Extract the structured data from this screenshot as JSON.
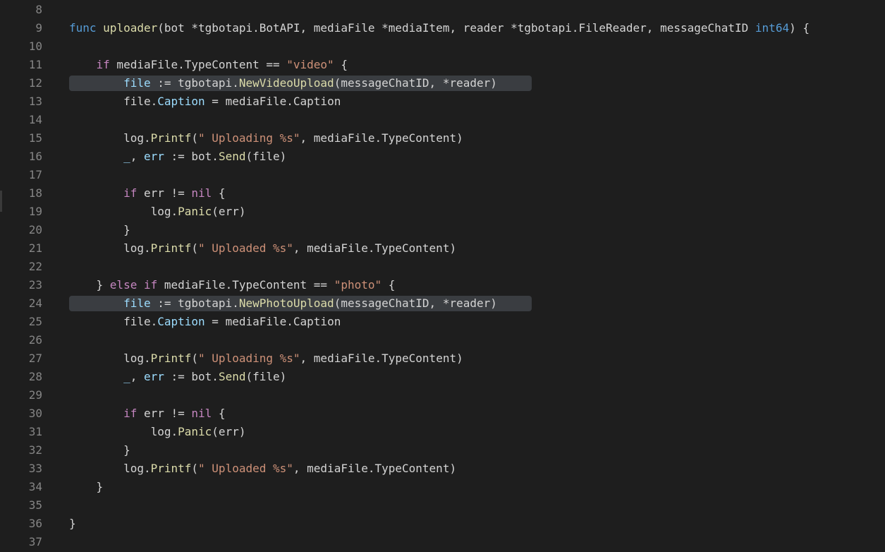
{
  "colors": {
    "background": "#1e1e1e",
    "line_number": "#858585",
    "keyword": "#c586c0",
    "function": "#dcdcaa",
    "string": "#ce9178",
    "variable": "#9cdcfe",
    "type": "#569cd6",
    "text": "#d4d4d4",
    "line_highlight": "#3a3d41"
  },
  "editor": {
    "lines": [
      {
        "number": "8",
        "highlight": false,
        "tokens": []
      },
      {
        "number": "9",
        "highlight": false,
        "tokens": [
          {
            "c": "type",
            "t": "func"
          },
          {
            "c": "plain",
            "t": " "
          },
          {
            "c": "fn",
            "t": "uploader"
          },
          {
            "c": "plain",
            "t": "(bot *tgbotapi.BotAPI, mediaFile *mediaItem, reader *tgbotapi.FileReader, messageChatID "
          },
          {
            "c": "type",
            "t": "int64"
          },
          {
            "c": "plain",
            "t": ") {"
          }
        ]
      },
      {
        "number": "10",
        "highlight": false,
        "tokens": []
      },
      {
        "number": "11",
        "highlight": false,
        "tokens": [
          {
            "c": "plain",
            "t": "    "
          },
          {
            "c": "kw",
            "t": "if"
          },
          {
            "c": "plain",
            "t": " mediaFile.TypeContent == "
          },
          {
            "c": "str",
            "t": "\"video\""
          },
          {
            "c": "plain",
            "t": " {"
          }
        ]
      },
      {
        "number": "12",
        "highlight": true,
        "tokens": [
          {
            "c": "plain",
            "t": "        "
          },
          {
            "c": "var",
            "t": "file"
          },
          {
            "c": "plain",
            "t": " := tgbotapi."
          },
          {
            "c": "fn",
            "t": "NewVideoUpload"
          },
          {
            "c": "plain",
            "t": "(messageChatID, *reader)"
          }
        ]
      },
      {
        "number": "13",
        "highlight": false,
        "tokens": [
          {
            "c": "plain",
            "t": "        file."
          },
          {
            "c": "var",
            "t": "Caption"
          },
          {
            "c": "plain",
            "t": " = mediaFile.Caption"
          }
        ]
      },
      {
        "number": "14",
        "highlight": false,
        "tokens": []
      },
      {
        "number": "15",
        "highlight": false,
        "tokens": [
          {
            "c": "plain",
            "t": "        log."
          },
          {
            "c": "fn",
            "t": "Printf"
          },
          {
            "c": "plain",
            "t": "("
          },
          {
            "c": "str",
            "t": "\" Uploading %s\""
          },
          {
            "c": "plain",
            "t": ", mediaFile.TypeContent)"
          }
        ]
      },
      {
        "number": "16",
        "highlight": false,
        "tokens": [
          {
            "c": "plain",
            "t": "        "
          },
          {
            "c": "var",
            "t": "_"
          },
          {
            "c": "plain",
            "t": ", "
          },
          {
            "c": "var",
            "t": "err"
          },
          {
            "c": "plain",
            "t": " := bot."
          },
          {
            "c": "fn",
            "t": "Send"
          },
          {
            "c": "plain",
            "t": "(file)"
          }
        ]
      },
      {
        "number": "17",
        "highlight": false,
        "tokens": []
      },
      {
        "number": "18",
        "highlight": false,
        "tokens": [
          {
            "c": "plain",
            "t": "        "
          },
          {
            "c": "kw",
            "t": "if"
          },
          {
            "c": "plain",
            "t": " err != "
          },
          {
            "c": "kw",
            "t": "nil"
          },
          {
            "c": "plain",
            "t": " {"
          }
        ]
      },
      {
        "number": "19",
        "highlight": false,
        "tokens": [
          {
            "c": "plain",
            "t": "            log."
          },
          {
            "c": "fn",
            "t": "Panic"
          },
          {
            "c": "plain",
            "t": "(err)"
          }
        ]
      },
      {
        "number": "20",
        "highlight": false,
        "tokens": [
          {
            "c": "plain",
            "t": "        }"
          }
        ]
      },
      {
        "number": "21",
        "highlight": false,
        "tokens": [
          {
            "c": "plain",
            "t": "        log."
          },
          {
            "c": "fn",
            "t": "Printf"
          },
          {
            "c": "plain",
            "t": "("
          },
          {
            "c": "str",
            "t": "\" Uploaded %s\""
          },
          {
            "c": "plain",
            "t": ", mediaFile.TypeContent)"
          }
        ]
      },
      {
        "number": "22",
        "highlight": false,
        "tokens": []
      },
      {
        "number": "23",
        "highlight": false,
        "tokens": [
          {
            "c": "plain",
            "t": "    } "
          },
          {
            "c": "kw",
            "t": "else if"
          },
          {
            "c": "plain",
            "t": " mediaFile.TypeContent == "
          },
          {
            "c": "str",
            "t": "\"photo\""
          },
          {
            "c": "plain",
            "t": " {"
          }
        ]
      },
      {
        "number": "24",
        "highlight": true,
        "tokens": [
          {
            "c": "plain",
            "t": "        "
          },
          {
            "c": "var",
            "t": "file"
          },
          {
            "c": "plain",
            "t": " := tgbotapi."
          },
          {
            "c": "fn",
            "t": "NewPhotoUpload"
          },
          {
            "c": "plain",
            "t": "(messageChatID, *reader)"
          }
        ]
      },
      {
        "number": "25",
        "highlight": false,
        "tokens": [
          {
            "c": "plain",
            "t": "        file."
          },
          {
            "c": "var",
            "t": "Caption"
          },
          {
            "c": "plain",
            "t": " = mediaFile.Caption"
          }
        ]
      },
      {
        "number": "26",
        "highlight": false,
        "tokens": []
      },
      {
        "number": "27",
        "highlight": false,
        "tokens": [
          {
            "c": "plain",
            "t": "        log."
          },
          {
            "c": "fn",
            "t": "Printf"
          },
          {
            "c": "plain",
            "t": "("
          },
          {
            "c": "str",
            "t": "\" Uploading %s\""
          },
          {
            "c": "plain",
            "t": ", mediaFile.TypeContent)"
          }
        ]
      },
      {
        "number": "28",
        "highlight": false,
        "tokens": [
          {
            "c": "plain",
            "t": "        "
          },
          {
            "c": "var",
            "t": "_"
          },
          {
            "c": "plain",
            "t": ", "
          },
          {
            "c": "var",
            "t": "err"
          },
          {
            "c": "plain",
            "t": " := bot."
          },
          {
            "c": "fn",
            "t": "Send"
          },
          {
            "c": "plain",
            "t": "(file)"
          }
        ]
      },
      {
        "number": "29",
        "highlight": false,
        "tokens": []
      },
      {
        "number": "30",
        "highlight": false,
        "tokens": [
          {
            "c": "plain",
            "t": "        "
          },
          {
            "c": "kw",
            "t": "if"
          },
          {
            "c": "plain",
            "t": " err != "
          },
          {
            "c": "kw",
            "t": "nil"
          },
          {
            "c": "plain",
            "t": " {"
          }
        ]
      },
      {
        "number": "31",
        "highlight": false,
        "tokens": [
          {
            "c": "plain",
            "t": "            log."
          },
          {
            "c": "fn",
            "t": "Panic"
          },
          {
            "c": "plain",
            "t": "(err)"
          }
        ]
      },
      {
        "number": "32",
        "highlight": false,
        "tokens": [
          {
            "c": "plain",
            "t": "        }"
          }
        ]
      },
      {
        "number": "33",
        "highlight": false,
        "tokens": [
          {
            "c": "plain",
            "t": "        log."
          },
          {
            "c": "fn",
            "t": "Printf"
          },
          {
            "c": "plain",
            "t": "("
          },
          {
            "c": "str",
            "t": "\" Uploaded %s\""
          },
          {
            "c": "plain",
            "t": ", mediaFile.TypeContent)"
          }
        ]
      },
      {
        "number": "34",
        "highlight": false,
        "tokens": [
          {
            "c": "plain",
            "t": "    }"
          }
        ]
      },
      {
        "number": "35",
        "highlight": false,
        "tokens": []
      },
      {
        "number": "36",
        "highlight": false,
        "tokens": [
          {
            "c": "plain",
            "t": "}"
          }
        ]
      },
      {
        "number": "37",
        "highlight": false,
        "tokens": []
      }
    ]
  }
}
